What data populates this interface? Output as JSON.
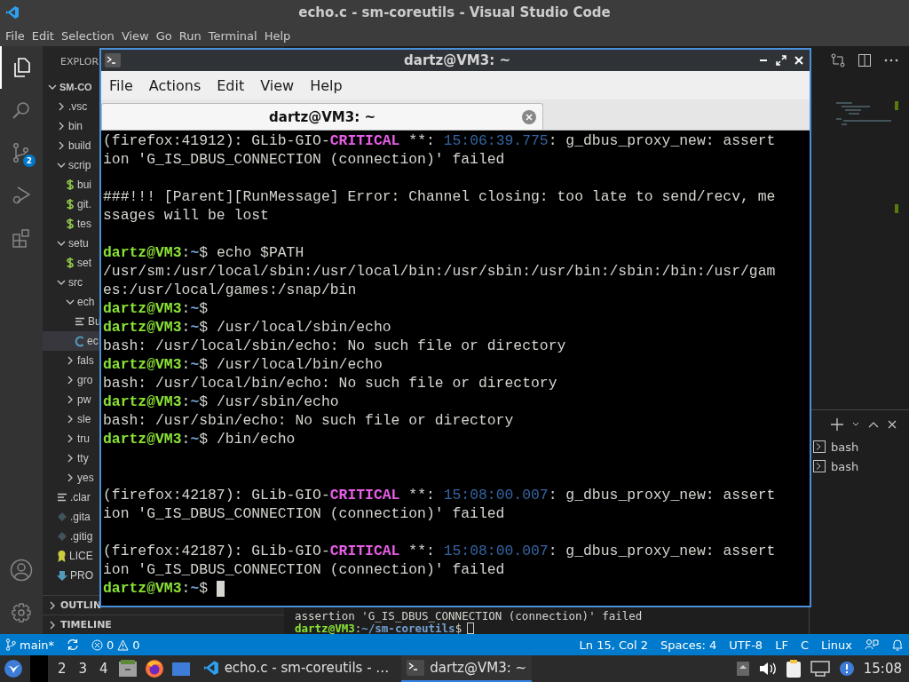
{
  "window": {
    "title": "echo.c - sm-coreutils - Visual Studio Code"
  },
  "menu": [
    "File",
    "Edit",
    "Selection",
    "View",
    "Go",
    "Run",
    "Terminal",
    "Help"
  ],
  "activity_bar": {
    "scm_badge": "2"
  },
  "sidebar": {
    "title": "EXPLOR",
    "tree": [
      {
        "label": "SM-CO",
        "kind": "folder",
        "expanded": true,
        "selected": false,
        "children": [
          {
            "label": ".vsc",
            "kind": "folder",
            "expanded": false,
            "selected": false
          },
          {
            "label": "bin",
            "kind": "folder",
            "expanded": false,
            "selected": false
          },
          {
            "label": "build",
            "kind": "folder",
            "expanded": false,
            "selected": false
          },
          {
            "label": "scrip",
            "kind": "folder",
            "expanded": true,
            "selected": false,
            "children": [
              {
                "label": "bui",
                "kind": "shell",
                "selected": false
              },
              {
                "label": "git.",
                "kind": "shell",
                "selected": false
              },
              {
                "label": "tes",
                "kind": "shell",
                "selected": false
              }
            ]
          },
          {
            "label": "setu",
            "kind": "folder",
            "expanded": true,
            "selected": false,
            "children": [
              {
                "label": "set",
                "kind": "shell",
                "selected": false
              }
            ]
          },
          {
            "label": "src",
            "kind": "folder",
            "expanded": true,
            "selected": false,
            "children": [
              {
                "label": "ech",
                "kind": "folder",
                "expanded": true,
                "selected": false,
                "children": [
                  {
                    "label": "Bu",
                    "kind": "lines",
                    "selected": false
                  },
                  {
                    "label": "ec",
                    "kind": "c",
                    "selected": true
                  }
                ]
              },
              {
                "label": "fals",
                "kind": "folder",
                "expanded": false,
                "selected": false
              },
              {
                "label": "gro",
                "kind": "folder",
                "expanded": false,
                "selected": false
              },
              {
                "label": "pw",
                "kind": "folder",
                "expanded": false,
                "selected": false
              },
              {
                "label": "sle",
                "kind": "folder",
                "expanded": false,
                "selected": false
              },
              {
                "label": "tru",
                "kind": "folder",
                "expanded": false,
                "selected": false
              },
              {
                "label": "tty",
                "kind": "folder",
                "expanded": false,
                "selected": false
              },
              {
                "label": "yes",
                "kind": "folder",
                "expanded": false,
                "selected": false
              }
            ]
          },
          {
            "label": ".clar",
            "kind": "lines",
            "selected": false
          },
          {
            "label": ".gita",
            "kind": "git",
            "selected": false
          },
          {
            "label": ".gitig",
            "kind": "git",
            "selected": false
          },
          {
            "label": "LICE",
            "kind": "license",
            "selected": false
          },
          {
            "label": "PRO",
            "kind": "markdown",
            "selected": false
          }
        ]
      }
    ],
    "sections": [
      {
        "label": "OUTLIN",
        "expanded": false
      },
      {
        "label": "TIMELINE",
        "expanded": false
      }
    ]
  },
  "panel": {
    "lines": [
      {
        "segments": [
          {
            "kind": "plain",
            "text": "assertion 'G_IS_DBUS_CONNECTION (connection)' failed"
          }
        ]
      },
      {
        "segments": [
          {
            "kind": "user",
            "text": "dartz@VM3"
          },
          {
            "kind": "plain",
            "text": ":"
          },
          {
            "kind": "path",
            "text": "~/sm-coreutils"
          },
          {
            "kind": "plain",
            "text": "$"
          }
        ],
        "cursor": true
      }
    ],
    "terminals": [
      {
        "label": "bash",
        "selected": false
      },
      {
        "label": "bash",
        "selected": false
      }
    ]
  },
  "status_bar": {
    "branch": "main*",
    "errors": "0",
    "warnings": "0",
    "right": [
      "Ln 15, Col 2",
      "Spaces: 4",
      "UTF-8",
      "LF",
      "C",
      "Linux"
    ]
  },
  "terminal_window": {
    "title": "dartz@VM3: ~",
    "menu": [
      "File",
      "Actions",
      "Edit",
      "View",
      "Help"
    ],
    "tabs": [
      {
        "label": "dartz@VM3: ~",
        "selected": true
      }
    ],
    "lines": [
      {
        "kind": "text",
        "segments": [
          {
            "kind": "plain",
            "text": "(firefox:41912): GLib-GIO-"
          },
          {
            "kind": "critical",
            "text": "CRITICAL"
          },
          {
            "kind": "plain",
            "text": " **: "
          },
          {
            "kind": "time",
            "text": "15:06:39.775"
          },
          {
            "kind": "plain",
            "text": ": g_dbus_proxy_new: assert"
          }
        ]
      },
      {
        "kind": "text",
        "segments": [
          {
            "kind": "plain",
            "text": "ion 'G_IS_DBUS_CONNECTION (connection)' failed"
          }
        ]
      },
      {
        "kind": "blank"
      },
      {
        "kind": "text",
        "segments": [
          {
            "kind": "plain",
            "text": "###!!! [Parent][RunMessage] Error: Channel closing: too late to send/recv, me"
          }
        ]
      },
      {
        "kind": "text",
        "segments": [
          {
            "kind": "plain",
            "text": "ssages will be lost"
          }
        ]
      },
      {
        "kind": "blank"
      },
      {
        "kind": "text",
        "segments": [
          {
            "kind": "user",
            "text": "dartz@VM3"
          },
          {
            "kind": "plain",
            "text": ":"
          },
          {
            "kind": "path",
            "text": "~"
          },
          {
            "kind": "plain",
            "text": "$ echo $PATH"
          }
        ]
      },
      {
        "kind": "text",
        "segments": [
          {
            "kind": "plain",
            "text": "/usr/sm:/usr/local/sbin:/usr/local/bin:/usr/sbin:/usr/bin:/sbin:/bin:/usr/gam"
          }
        ]
      },
      {
        "kind": "text",
        "segments": [
          {
            "kind": "plain",
            "text": "es:/usr/local/games:/snap/bin"
          }
        ]
      },
      {
        "kind": "text",
        "segments": [
          {
            "kind": "user",
            "text": "dartz@VM3"
          },
          {
            "kind": "plain",
            "text": ":"
          },
          {
            "kind": "path",
            "text": "~"
          },
          {
            "kind": "plain",
            "text": "$"
          }
        ]
      },
      {
        "kind": "text",
        "segments": [
          {
            "kind": "user",
            "text": "dartz@VM3"
          },
          {
            "kind": "plain",
            "text": ":"
          },
          {
            "kind": "path",
            "text": "~"
          },
          {
            "kind": "plain",
            "text": "$ /usr/local/sbin/echo"
          }
        ]
      },
      {
        "kind": "text",
        "segments": [
          {
            "kind": "plain",
            "text": "bash: /usr/local/sbin/echo: No such file or directory"
          }
        ]
      },
      {
        "kind": "text",
        "segments": [
          {
            "kind": "user",
            "text": "dartz@VM3"
          },
          {
            "kind": "plain",
            "text": ":"
          },
          {
            "kind": "path",
            "text": "~"
          },
          {
            "kind": "plain",
            "text": "$ /usr/local/bin/echo"
          }
        ]
      },
      {
        "kind": "text",
        "segments": [
          {
            "kind": "plain",
            "text": "bash: /usr/local/bin/echo: No such file or directory"
          }
        ]
      },
      {
        "kind": "text",
        "segments": [
          {
            "kind": "user",
            "text": "dartz@VM3"
          },
          {
            "kind": "plain",
            "text": ":"
          },
          {
            "kind": "path",
            "text": "~"
          },
          {
            "kind": "plain",
            "text": "$ /usr/sbin/echo"
          }
        ]
      },
      {
        "kind": "text",
        "segments": [
          {
            "kind": "plain",
            "text": "bash: /usr/sbin/echo: No such file or directory"
          }
        ]
      },
      {
        "kind": "text",
        "segments": [
          {
            "kind": "user",
            "text": "dartz@VM3"
          },
          {
            "kind": "plain",
            "text": ":"
          },
          {
            "kind": "path",
            "text": "~"
          },
          {
            "kind": "plain",
            "text": "$ /bin/echo"
          }
        ]
      },
      {
        "kind": "blank"
      },
      {
        "kind": "blank"
      },
      {
        "kind": "text",
        "segments": [
          {
            "kind": "plain",
            "text": "(firefox:42187): GLib-GIO-"
          },
          {
            "kind": "critical",
            "text": "CRITICAL"
          },
          {
            "kind": "plain",
            "text": " **: "
          },
          {
            "kind": "time",
            "text": "15:08:00.007"
          },
          {
            "kind": "plain",
            "text": ": g_dbus_proxy_new: assert"
          }
        ]
      },
      {
        "kind": "text",
        "segments": [
          {
            "kind": "plain",
            "text": "ion 'G_IS_DBUS_CONNECTION (connection)' failed"
          }
        ]
      },
      {
        "kind": "blank"
      },
      {
        "kind": "text",
        "segments": [
          {
            "kind": "plain",
            "text": "(firefox:42187): GLib-GIO-"
          },
          {
            "kind": "critical",
            "text": "CRITICAL"
          },
          {
            "kind": "plain",
            "text": " **: "
          },
          {
            "kind": "time",
            "text": "15:08:00.007"
          },
          {
            "kind": "plain",
            "text": ": g_dbus_proxy_new: assert"
          }
        ]
      },
      {
        "kind": "text",
        "segments": [
          {
            "kind": "plain",
            "text": "ion 'G_IS_DBUS_CONNECTION (connection)' failed"
          }
        ]
      },
      {
        "kind": "text",
        "segments": [
          {
            "kind": "user",
            "text": "dartz@VM3"
          },
          {
            "kind": "plain",
            "text": ":"
          },
          {
            "kind": "path",
            "text": "~"
          },
          {
            "kind": "plain",
            "text": "$"
          }
        ],
        "cursor": true
      }
    ]
  },
  "taskbar": {
    "workspaces": [
      "2",
      "3",
      "4"
    ],
    "tasks": [
      {
        "kind": "vscode",
        "label": "echo.c - sm-coreutils - …",
        "selected": false
      },
      {
        "kind": "terminal",
        "label": "dartz@VM3: ~",
        "selected": true
      }
    ],
    "clock": "15:08"
  }
}
